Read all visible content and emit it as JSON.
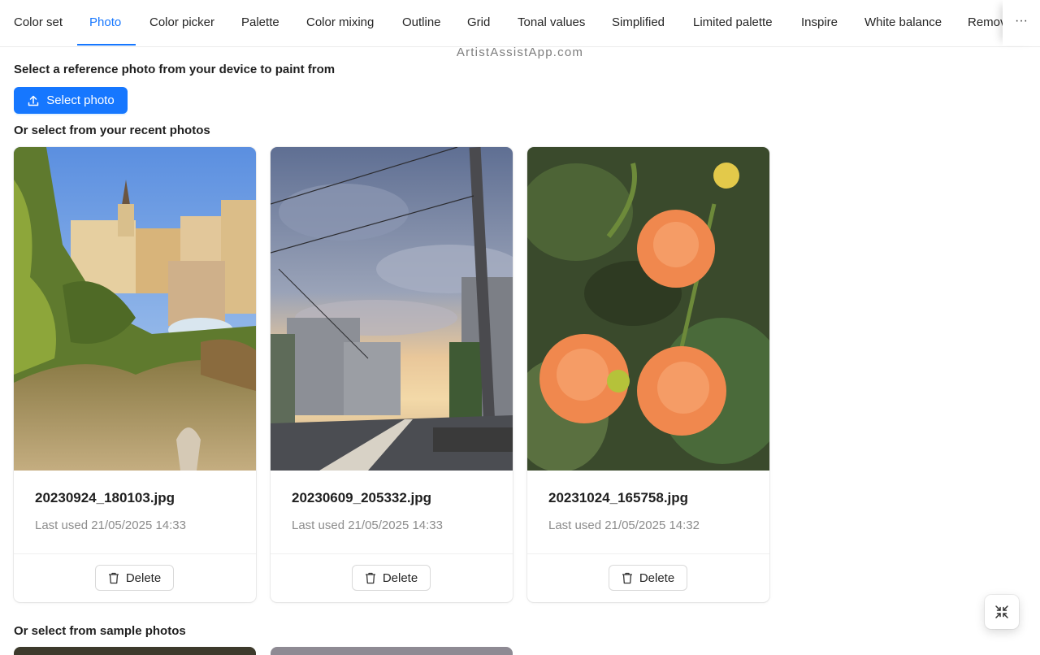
{
  "tabs": [
    {
      "label": "Color set"
    },
    {
      "label": "Photo"
    },
    {
      "label": "Color picker"
    },
    {
      "label": "Palette"
    },
    {
      "label": "Color mixing"
    },
    {
      "label": "Outline"
    },
    {
      "label": "Grid"
    },
    {
      "label": "Tonal values"
    },
    {
      "label": "Simplified"
    },
    {
      "label": "Limited palette"
    },
    {
      "label": "Inspire"
    },
    {
      "label": "White balance"
    },
    {
      "label": "Remov"
    }
  ],
  "active_tab": "Photo",
  "tab_more_label": "···",
  "brand": "ArtistAssistApp.com",
  "select_heading": "Select a reference photo from your device to paint from",
  "select_button_label": "Select photo",
  "recent_heading": "Or select from your recent photos",
  "recent_photos": [
    {
      "filename": "20230924_180103.jpg",
      "last_used": "Last used 21/05/2025 14:33",
      "delete_label": "Delete"
    },
    {
      "filename": "20230609_205332.jpg",
      "last_used": "Last used 21/05/2025 14:33",
      "delete_label": "Delete"
    },
    {
      "filename": "20231024_165758.jpg",
      "last_used": "Last used 21/05/2025 14:32",
      "delete_label": "Delete"
    }
  ],
  "sample_heading": "Or select from sample photos",
  "icons": {
    "upload": "upload-icon",
    "delete": "trash-icon",
    "fullscreen_exit": "fullscreen-exit-icon",
    "more": "ellipsis-icon"
  },
  "colors": {
    "primary": "#1677ff",
    "text": "#1f1f1f",
    "secondary_text": "#8c8c8c"
  }
}
